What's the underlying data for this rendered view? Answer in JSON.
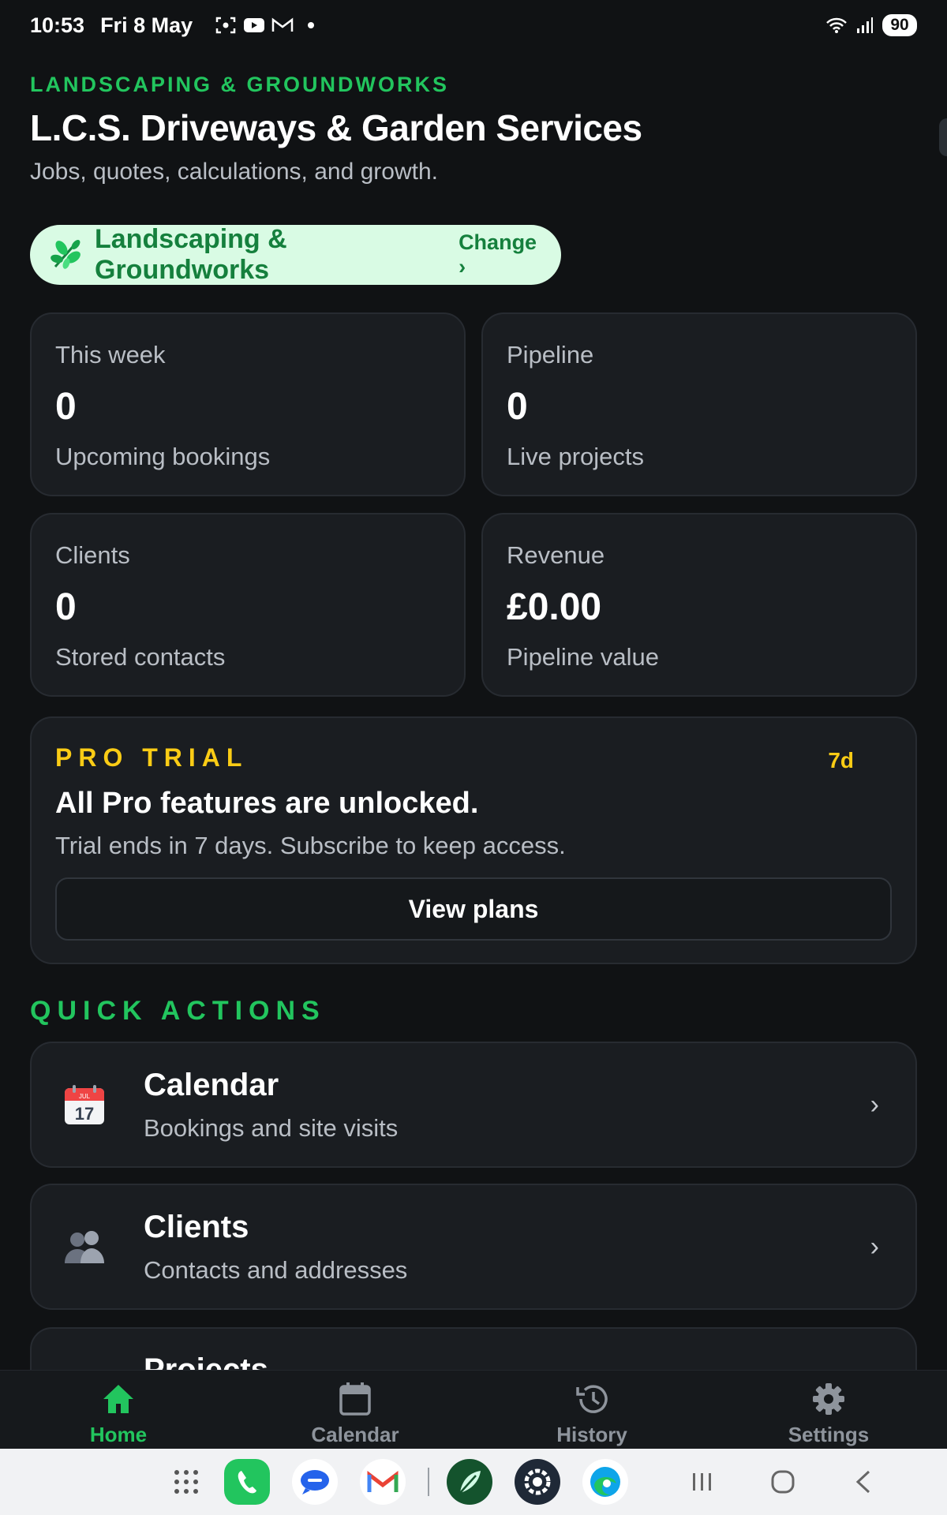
{
  "status_bar": {
    "time": "10:53",
    "date": "Fri 8 May",
    "battery": "90"
  },
  "header": {
    "category": "LANDSCAPING & GROUNDWORKS",
    "title": "L.C.S. Driveways & Garden Services",
    "subtitle": "Jobs, quotes, calculations, and growth."
  },
  "trade_pill": {
    "label": "Landscaping & Groundworks",
    "change_label": "Change ›"
  },
  "stats": [
    {
      "label": "This week",
      "value": "0",
      "caption": "Upcoming bookings"
    },
    {
      "label": "Pipeline",
      "value": "0",
      "caption": "Live projects"
    },
    {
      "label": "Clients",
      "value": "0",
      "caption": "Stored contacts"
    },
    {
      "label": "Revenue",
      "value": "£0.00",
      "caption": "Pipeline value"
    }
  ],
  "trial": {
    "tag": "PRO TRIAL",
    "days": "7d",
    "title": "All Pro features are unlocked.",
    "subtitle": "Trial ends in 7 days. Subscribe to keep access.",
    "button_label": "View plans"
  },
  "quick_actions": {
    "title": "QUICK ACTIONS",
    "items": [
      {
        "title": "Calendar",
        "subtitle": "Bookings and site visits",
        "icon": "calendar-17-icon",
        "chevron": "›"
      },
      {
        "title": "Clients",
        "subtitle": "Contacts and addresses",
        "icon": "people-icon",
        "chevron": "›"
      },
      {
        "title": "Projects",
        "subtitle": "",
        "icon": "",
        "chevron": ""
      }
    ]
  },
  "calendar_icon_day": "17",
  "calendar_icon_month": "JUL",
  "bottom_nav": [
    {
      "label": "Home",
      "icon": "home-icon",
      "active": true
    },
    {
      "label": "Calendar",
      "icon": "calendar-icon",
      "active": false
    },
    {
      "label": "History",
      "icon": "history-icon",
      "active": false
    },
    {
      "label": "Settings",
      "icon": "gear-icon",
      "active": false
    }
  ],
  "colors": {
    "background": "#101214",
    "card": "#1a1d21",
    "accent_green": "#22c55e",
    "trial_yellow": "#facc15",
    "pill_bg": "#d9fbe4"
  }
}
